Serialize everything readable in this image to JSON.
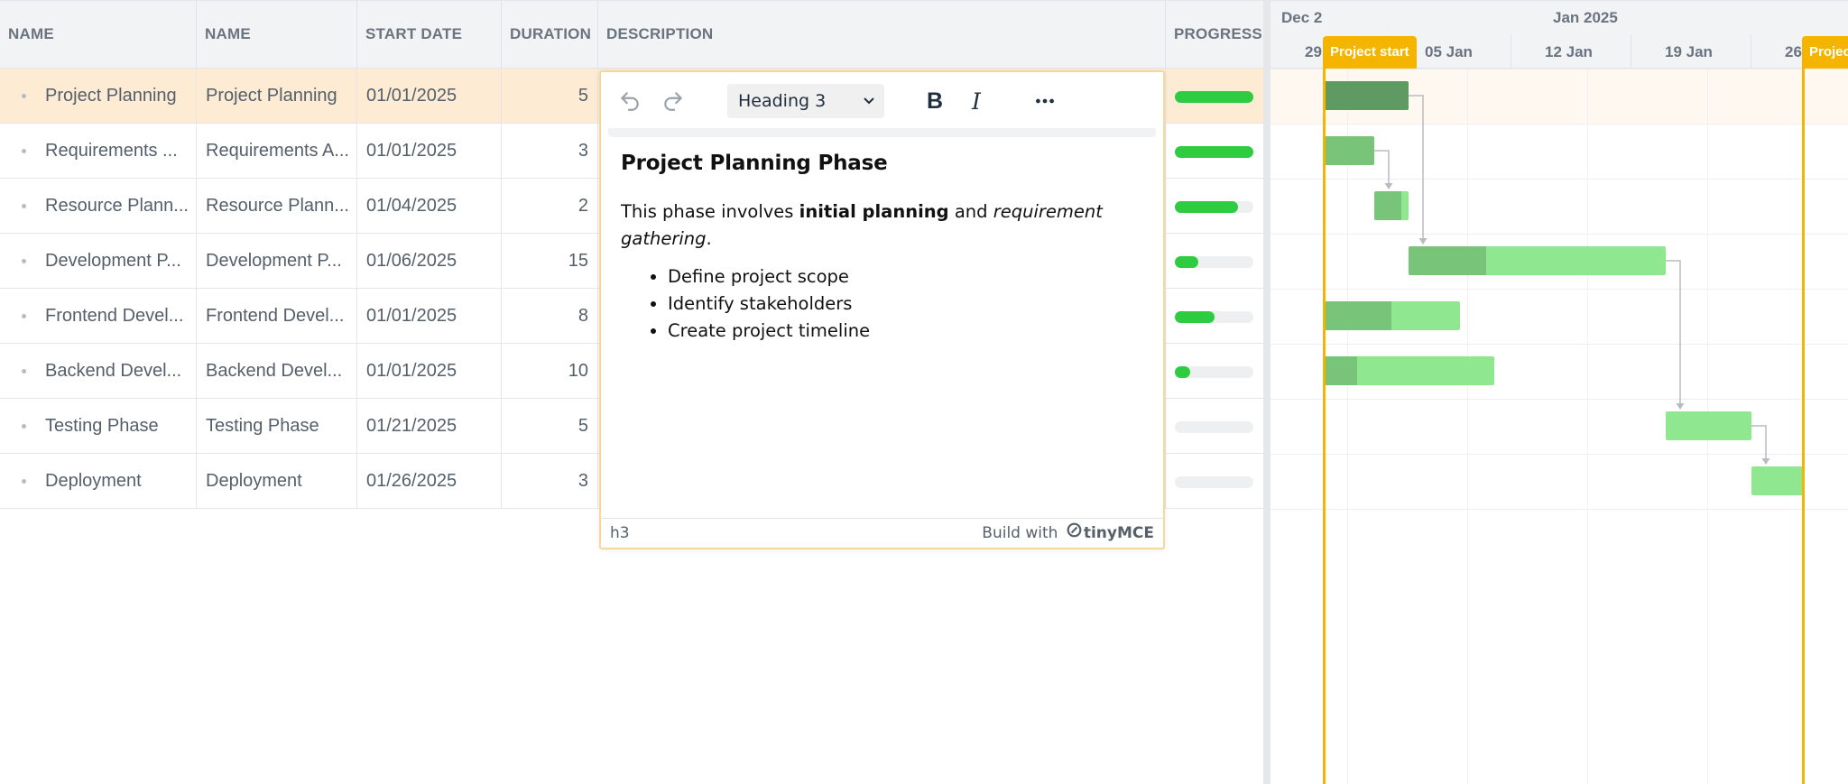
{
  "grid": {
    "columns": [
      "NAME",
      "NAME",
      "START DATE",
      "DURATION",
      "DESCRIPTION",
      "PROGRESS"
    ],
    "rows": [
      {
        "name": "Project Planning",
        "name2": "Project Planning",
        "start": "01/01/2025",
        "duration": "5",
        "progress": 1.0
      },
      {
        "name": "Requirements ...",
        "name2": "Requirements A...",
        "start": "01/01/2025",
        "duration": "3",
        "progress": 1.0
      },
      {
        "name": "Resource Plann...",
        "name2": "Resource Plann...",
        "start": "01/04/2025",
        "duration": "2",
        "progress": 0.8
      },
      {
        "name": "Development P...",
        "name2": "Development P...",
        "start": "01/06/2025",
        "duration": "15",
        "progress": 0.3
      },
      {
        "name": "Frontend Devel...",
        "name2": "Frontend Devel...",
        "start": "01/01/2025",
        "duration": "8",
        "progress": 0.5
      },
      {
        "name": "Backend Devel...",
        "name2": "Backend Devel...",
        "start": "01/01/2025",
        "duration": "10",
        "progress": 0.2
      },
      {
        "name": "Testing Phase",
        "name2": "Testing Phase",
        "start": "01/21/2025",
        "duration": "5",
        "progress": 0.0
      },
      {
        "name": "Deployment",
        "name2": "Deployment",
        "start": "01/26/2025",
        "duration": "3",
        "progress": 0.0
      }
    ]
  },
  "timeline": {
    "months": {
      "prev": "Dec 2",
      "current": "Jan 2025"
    },
    "weeks": [
      "29",
      "05 Jan",
      "12 Jan",
      "19 Jan",
      "26"
    ],
    "markers": {
      "start": "Project start",
      "end": "Projec"
    },
    "colors": {
      "marker": "#f5b400",
      "bar": "#8fe88f",
      "bar_done": "#78c478",
      "bar_done_dark": "#5f9a63",
      "progress": "#2ecc40"
    }
  },
  "editor": {
    "toolbar": {
      "format": "Heading 3",
      "undo_icon": "undo-icon",
      "redo_icon": "redo-icon",
      "bold": "B",
      "italic": "I",
      "more_icon": "more-icon"
    },
    "heading": "Project Planning Phase",
    "para": {
      "t1": "This phase involves ",
      "b": "initial planning",
      "t2": " and ",
      "i": "requirement gathering",
      "t3": "."
    },
    "list": [
      "Define project scope",
      "Identify stakeholders",
      "Create project timeline"
    ],
    "status": {
      "path": "h3",
      "built": "Build with",
      "brand": "tinyMCE"
    }
  }
}
